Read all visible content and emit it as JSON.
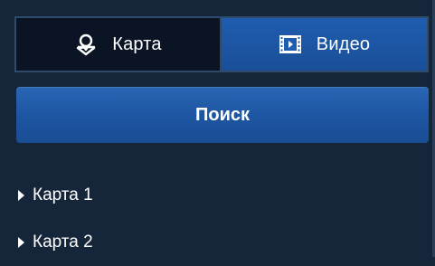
{
  "tabs": [
    {
      "label": "Карта",
      "icon": "map-pin-icon",
      "active": false
    },
    {
      "label": "Видео",
      "icon": "video-film-icon",
      "active": true
    }
  ],
  "search": {
    "label": "Поиск"
  },
  "tree": {
    "items": [
      {
        "label": "Карта 1"
      },
      {
        "label": "Карта 2"
      }
    ]
  },
  "colors": {
    "background": "#16263a",
    "active_tab": "#1f5db0",
    "inactive_tab": "#0a1424",
    "button": "#1d56a3"
  }
}
